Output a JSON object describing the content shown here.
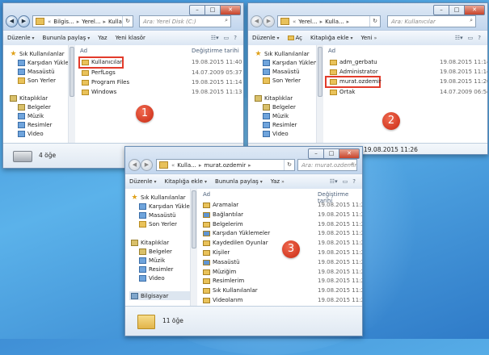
{
  "w1": {
    "addr": [
      "Bilgis...",
      "Yerel...",
      "Kullanıcılar"
    ],
    "search_placeholder": "Ara: Yerel Disk (C:)",
    "toolbar": [
      "Düzenle",
      "Bununla paylaş",
      "Yaz",
      "Yeni klasör"
    ],
    "nav": {
      "favorites": "Sık Kullanılanlar",
      "downloads": "Karşıdan Yüklem",
      "desktop": "Masaüstü",
      "recent": "Son Yerler",
      "libraries": "Kitaplıklar",
      "documents": "Belgeler",
      "music": "Müzik",
      "pictures": "Resimler",
      "video": "Video"
    },
    "col_name": "Ad",
    "col_date": "Değiştirme tarihi",
    "rows": [
      {
        "name": "Kullanıcılar",
        "date": "19.08.2015 11:40"
      },
      {
        "name": "PerfLogs",
        "date": "14.07.2009 05:37"
      },
      {
        "name": "Program Files",
        "date": "19.08.2015 11:14"
      },
      {
        "name": "Windows",
        "date": "19.08.2015 11:13"
      }
    ],
    "status": "4 öğe",
    "badge": "1"
  },
  "w2": {
    "addr": [
      "Yerel...",
      "Kulla...",
      "Kullanıcılar"
    ],
    "search_placeholder": "Ara: Kullanıcılar",
    "toolbar": [
      "Düzenle",
      "Aç",
      "Kitaplığa ekle",
      "Yeni"
    ],
    "nav": {
      "favorites": "Sık Kullanılanlar",
      "downloads": "Karşıdan Yüklem",
      "desktop": "Masaüstü",
      "recent": "Son Yerler",
      "libraries": "Kitaplıklar",
      "documents": "Belgeler",
      "music": "Müzik",
      "pictures": "Resimler",
      "video": "Video"
    },
    "col_name": "Ad",
    "rows": [
      {
        "name": "adm_gerbatu",
        "date": "19.08.2015 11:14"
      },
      {
        "name": "Administrator",
        "date": "19.08.2015 11:14"
      },
      {
        "name": "murat.ozdemir",
        "date": "19.08.2015 11:26"
      },
      {
        "name": "Ortak",
        "date": "14.07.2009 06:54"
      }
    ],
    "status_date": "19.08.2015 11:26",
    "badge": "2"
  },
  "w3": {
    "addr": [
      "Kulla...",
      "murat.ozdemir"
    ],
    "search_placeholder": "Ara: murat.ozdemir",
    "toolbar": [
      "Düzenle",
      "Kitaplığa ekle",
      "Bununla paylaş",
      "Yaz"
    ],
    "nav": {
      "favorites": "Sık Kullanılanlar",
      "downloads": "Karşıdan Yüklem",
      "desktop": "Masaüstü",
      "recent": "Son Yerler",
      "libraries": "Kitaplıklar",
      "documents": "Belgeler",
      "music": "Müzik",
      "pictures": "Resimler",
      "video": "Video",
      "computer": "Bilgisayar"
    },
    "col_name": "Ad",
    "col_date": "Değiştirme tarihi",
    "rows": [
      {
        "name": "Aramalar",
        "date": "19.08.2015 11:26"
      },
      {
        "name": "Bağlantılar",
        "date": "19.08.2015 11:26"
      },
      {
        "name": "Belgelerim",
        "date": "19.08.2015 11:26"
      },
      {
        "name": "Karşıdan Yüklemeler",
        "date": "19.08.2015 11:26"
      },
      {
        "name": "Kaydedilen Oyunlar",
        "date": "19.08.2015 11:26"
      },
      {
        "name": "Kişiler",
        "date": "19.08.2015 11:26"
      },
      {
        "name": "Masaüstü",
        "date": "19.08.2015 11:26"
      },
      {
        "name": "Müziğim",
        "date": "19.08.2015 11:26"
      },
      {
        "name": "Resimlerim",
        "date": "19.08.2015 11:26"
      },
      {
        "name": "Sık Kullanılanlar",
        "date": "19.08.2015 11:26"
      },
      {
        "name": "Videolarım",
        "date": "19.08.2015 11:26"
      }
    ],
    "status": "11 öğe",
    "badge": "3"
  }
}
